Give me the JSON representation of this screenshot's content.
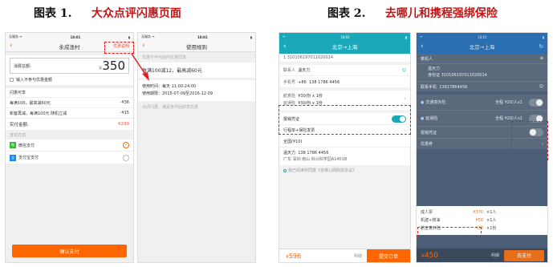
{
  "fig1": {
    "number": "图表 1.",
    "title": "大众点评闪惠页面"
  },
  "fig2": {
    "number": "图表 2.",
    "title": "去哪儿和携程强绑保险"
  },
  "dp1": {
    "status": {
      "carrier": "无服务 ᯤ",
      "time": "18:01",
      "battery": "▮"
    },
    "title": "永成渔村",
    "benefit": "优惠说明",
    "consume_label": "消费总额:",
    "amount_prefix": "¥",
    "amount": "350",
    "checkbox": "输入不参与优惠金额",
    "section": "闪惠可享",
    "items": [
      {
        "name": "每满100，最高减60元",
        "value": "-¥36"
      },
      {
        "name": "新客再减，每满100元 随机立减",
        "value": "-¥15"
      }
    ],
    "pay_label": "实付金额:",
    "pay_value": "¥299",
    "method_title": "支付方式",
    "methods": [
      {
        "name": "微信支付",
        "icon": "微"
      },
      {
        "name": "支付宝支付",
        "icon": "支"
      }
    ],
    "confirm": "确认支付"
  },
  "dp2": {
    "status": {
      "carrier": "无服务 ᯤ",
      "time": "18:01",
      "battery": "▮"
    },
    "title": "使用规则",
    "note": "优惠不可与店内优惠同享",
    "rule": "每满100减12，最高减60元",
    "time_label": "使用时间：每天 11:00-24:00",
    "period": "使用期限：2015-07-09至2016-12-09",
    "foot": "点评闪惠，满足条件后即享优惠"
  },
  "qn": {
    "route": "北京→上海",
    "id_line": "1 310106197011020014",
    "contact_label": "联系人",
    "contact_name": "温天力",
    "phone_label": "手机号",
    "phone_cc": "+86",
    "phone": "138 1786 4456",
    "ins1_label": "航意险",
    "ins1_value": "¥30/份 x 1份",
    "ins2_label": "延误险",
    "ins2_value": "¥30/份 x 1份",
    "voucher": "报销凭证",
    "invoice": "行程单+保险发票",
    "region": "全国(¥10)",
    "addr_name": "温天力",
    "addr_phone": "138 1786 4456",
    "addr_line": "广东 深圳 南山 科兴科学园A1401B",
    "agree": "我已阅读并同意《去哪儿网购票协议》",
    "price_prefix": "¥",
    "price": "596",
    "detail": "明细",
    "submit": "提交订单"
  },
  "ct": {
    "route": "北京→上海",
    "passenger_label": "乘机人",
    "name": "温天力",
    "id": "身份证 310106197011020014",
    "contact_label": "联系手机",
    "contact_phone": "13817864456",
    "ins1_label": "交通意外险",
    "ins1_price": "全程 ¥20/人x1",
    "ins2_label": "延误险",
    "ins2_price": "全程 ¥20/人x1",
    "voucher": "报销凭证",
    "coupon": "优惠券",
    "row1_label": "成人票",
    "row1_price": "¥370",
    "row1_qty": "×1人",
    "row2_label": "机建+燃油",
    "row2_price": "¥50",
    "row2_qty": "×1人",
    "row3_label": "航空意外险",
    "row3_price": "¥30",
    "row3_qty": "×1份",
    "price_prefix": "¥",
    "price": "450",
    "detail": "明细",
    "submit": "去支付"
  }
}
